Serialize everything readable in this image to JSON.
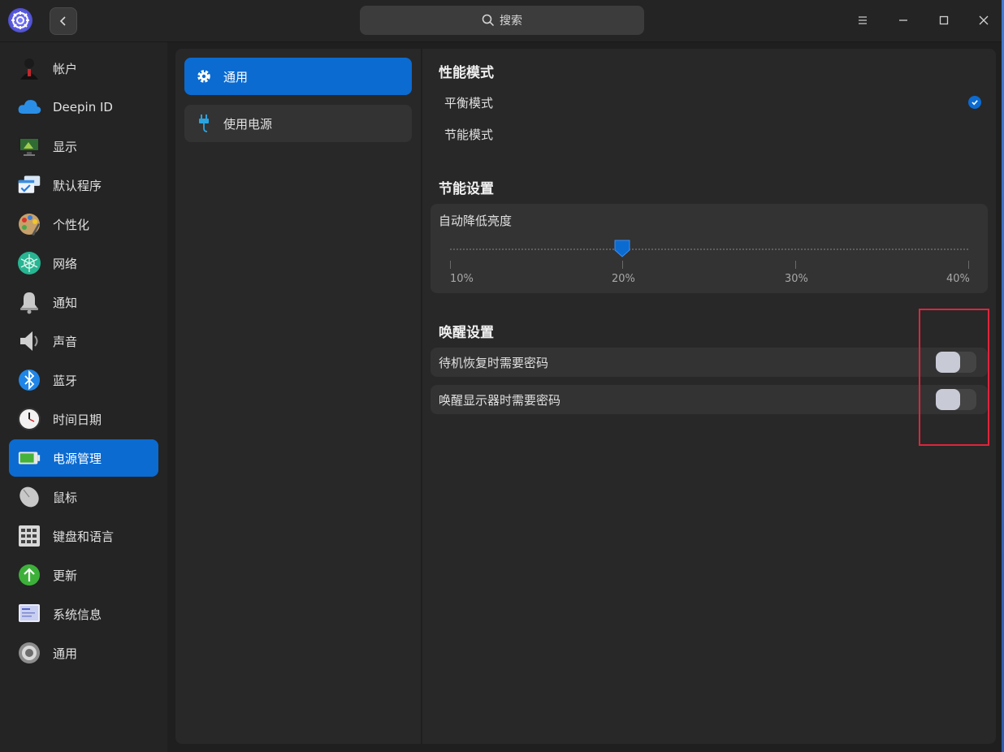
{
  "titlebar": {
    "search_placeholder": "搜索"
  },
  "sidebar": {
    "items": [
      {
        "label": "帐户",
        "icon": "account-icon"
      },
      {
        "label": "Deepin ID",
        "icon": "cloud-icon"
      },
      {
        "label": "显示",
        "icon": "display-icon"
      },
      {
        "label": "默认程序",
        "icon": "default-apps-icon"
      },
      {
        "label": "个性化",
        "icon": "personalization-icon"
      },
      {
        "label": "网络",
        "icon": "network-icon"
      },
      {
        "label": "通知",
        "icon": "bell-icon"
      },
      {
        "label": "声音",
        "icon": "speaker-icon"
      },
      {
        "label": "蓝牙",
        "icon": "bluetooth-icon"
      },
      {
        "label": "时间日期",
        "icon": "clock-icon"
      },
      {
        "label": "电源管理",
        "icon": "battery-icon",
        "active": true
      },
      {
        "label": "鼠标",
        "icon": "mouse-icon"
      },
      {
        "label": "键盘和语言",
        "icon": "keyboard-icon"
      },
      {
        "label": "更新",
        "icon": "update-icon"
      },
      {
        "label": "系统信息",
        "icon": "system-info-icon"
      },
      {
        "label": "通用",
        "icon": "gear-icon"
      }
    ]
  },
  "subnav": {
    "items": [
      {
        "label": "通用",
        "icon": "gear-icon",
        "active": true
      },
      {
        "label": "使用电源",
        "icon": "plug-icon"
      }
    ]
  },
  "performance": {
    "title": "性能模式",
    "modes": [
      {
        "label": "平衡模式",
        "selected": true
      },
      {
        "label": "节能模式",
        "selected": false
      }
    ]
  },
  "power_saving": {
    "title": "节能设置",
    "brightness_label": "自动降低亮度",
    "ticks": [
      "10%",
      "20%",
      "30%",
      "40%"
    ],
    "value_fraction": 0.333
  },
  "wakeup": {
    "title": "唤醒设置",
    "options": [
      {
        "label": "待机恢复时需要密码",
        "enabled": false
      },
      {
        "label": "唤醒显示器时需要密码",
        "enabled": false
      }
    ]
  },
  "colors": {
    "accent": "#0b6bd1",
    "highlight_box": "#e0243c"
  }
}
